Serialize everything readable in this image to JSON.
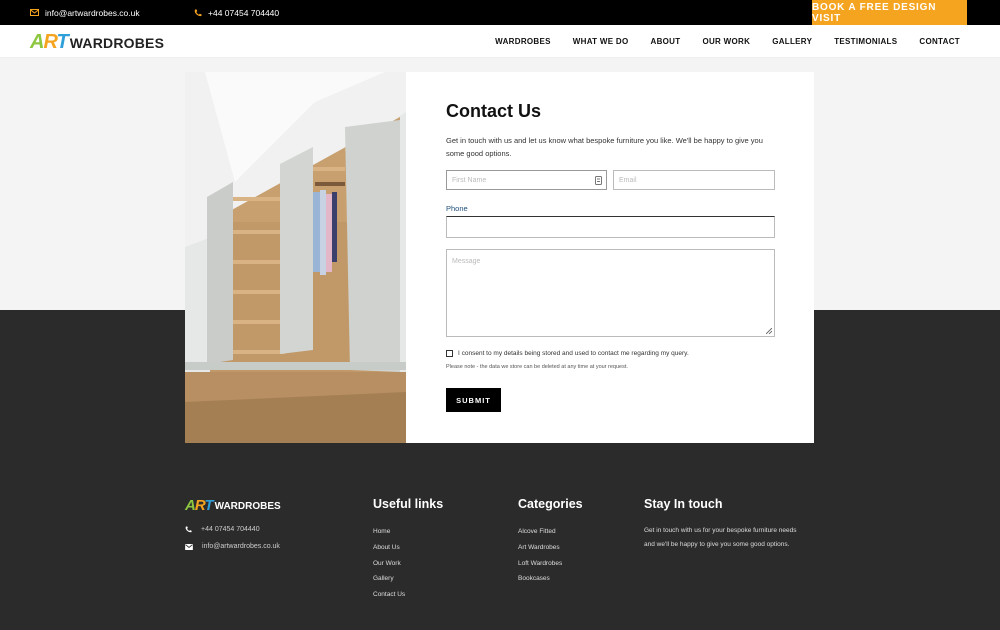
{
  "topbar": {
    "email": "info@artwardrobes.co.uk",
    "phone": "+44 07454 704440",
    "book_button": "BOOK A FREE DESIGN VISIT"
  },
  "brand": {
    "logo_art": "ART",
    "logo_word": "WARDROBES"
  },
  "nav": {
    "items": [
      "WARDROBES",
      "WHAT WE DO",
      "ABOUT",
      "OUR WORK",
      "GALLERY",
      "TESTIMONIALS",
      "CONTACT"
    ]
  },
  "contact_form": {
    "title": "Contact Us",
    "intro": "Get in touch with us and let us know what bespoke furniture you like. We'll be happy to give you some good options.",
    "first_name_placeholder": "First Name",
    "email_placeholder": "Email",
    "phone_label": "Phone",
    "message_placeholder": "Message",
    "consent_text": "I consent to my details being stored and used to contact me regarding my query.",
    "note": "Please note - the data we store can be deleted at any time at your request.",
    "submit_label": "SUBMIT"
  },
  "footer": {
    "phone": "+44 07454 704440",
    "email": "info@artwardrobes.co.uk",
    "useful_links": {
      "title": "Useful links",
      "items": [
        "Home",
        "About Us",
        "Our Work",
        "Gallery",
        "Contact Us"
      ]
    },
    "categories": {
      "title": "Categories",
      "items": [
        "Alcove Fitted",
        "Art Wardrobes",
        "Loft Wardrobes",
        "Bookcases"
      ]
    },
    "stay_in_touch": {
      "title": "Stay In touch",
      "text": "Get in touch with us for your bespoke furniture needs and we'll be happy to give you some good options."
    }
  },
  "colors": {
    "accent": "#f5a41f",
    "dark_band": "#2b2b2b",
    "logo_green": "#8dc63f",
    "logo_blue": "#2e9fd8"
  }
}
